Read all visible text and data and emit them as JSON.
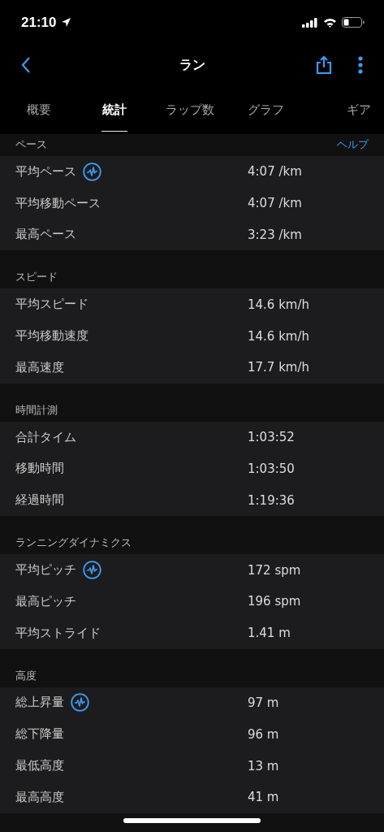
{
  "status_bar": {
    "time": "21:10"
  },
  "nav": {
    "title": "ラン"
  },
  "tabs": [
    {
      "label": "概要",
      "selected": false
    },
    {
      "label": "統計",
      "selected": true
    },
    {
      "label": "ラップ数",
      "selected": false
    },
    {
      "label": "グラフ",
      "selected": false
    },
    {
      "label": "ギア",
      "selected": false
    }
  ],
  "sections": [
    {
      "title": "ペース",
      "help": "ヘルプ",
      "rows": [
        {
          "label": "平均ペース",
          "value": "4:07 /km",
          "chart_link": true
        },
        {
          "label": "平均移動ペース",
          "value": "4:07 /km",
          "chart_link": false
        },
        {
          "label": "最高ペース",
          "value": "3:23 /km",
          "chart_link": false
        }
      ]
    },
    {
      "title": "スピード",
      "rows": [
        {
          "label": "平均スピード",
          "value": "14.6 km/h",
          "chart_link": false
        },
        {
          "label": "平均移動速度",
          "value": "14.6 km/h",
          "chart_link": false
        },
        {
          "label": "最高速度",
          "value": "17.7 km/h",
          "chart_link": false
        }
      ]
    },
    {
      "title": "時間計測",
      "rows": [
        {
          "label": "合計タイム",
          "value": "1:03:52",
          "chart_link": false
        },
        {
          "label": "移動時間",
          "value": "1:03:50",
          "chart_link": false
        },
        {
          "label": "経過時間",
          "value": "1:19:36",
          "chart_link": false
        }
      ]
    },
    {
      "title": "ランニングダイナミクス",
      "rows": [
        {
          "label": "平均ピッチ",
          "value": "172 spm",
          "chart_link": true
        },
        {
          "label": "最高ピッチ",
          "value": "196 spm",
          "chart_link": false
        },
        {
          "label": "平均ストライド",
          "value": "1.41 m",
          "chart_link": false
        }
      ]
    },
    {
      "title": "高度",
      "rows": [
        {
          "label": "総上昇量",
          "value": "97 m",
          "chart_link": true
        },
        {
          "label": "総下降量",
          "value": "96 m",
          "chart_link": false
        },
        {
          "label": "最低高度",
          "value": "13 m",
          "chart_link": false
        },
        {
          "label": "最高高度",
          "value": "41 m",
          "chart_link": false
        }
      ]
    }
  ]
}
